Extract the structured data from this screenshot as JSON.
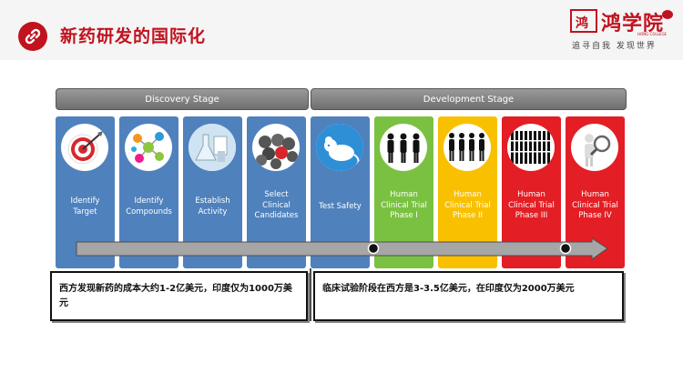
{
  "header": {
    "title": "新药研发的国际化",
    "logo": {
      "mark": "鸿",
      "name": "鸿学院",
      "sub": "HONG COLLEGE",
      "slogan": "追寻自我 发现世界"
    }
  },
  "stages": {
    "discovery": "Discovery Stage",
    "development": "Development Stage"
  },
  "cards": [
    {
      "label": "Identify\nTarget",
      "icon": "target-icon",
      "color": "#4f81bd"
    },
    {
      "label": "Identify\nCompounds",
      "icon": "molecule-icon",
      "color": "#4f81bd"
    },
    {
      "label": "Establish\nActivity",
      "icon": "lab-icon",
      "color": "#4f81bd"
    },
    {
      "label": "Select\nClinical\nCandidates",
      "icon": "candidates-icon",
      "color": "#4f81bd"
    },
    {
      "label": "Test Safety",
      "icon": "mouse-icon",
      "color": "#4f81bd"
    },
    {
      "label": "Human\nClinical Trial\nPhase I",
      "icon": "people-icon",
      "color": "#7ac142"
    },
    {
      "label": "Human\nClinical Trial\nPhase II",
      "icon": "people-icon",
      "color": "#f9c000"
    },
    {
      "label": "Human\nClinical Trial\nPhase III",
      "icon": "crowd-icon",
      "color": "#e31e24"
    },
    {
      "label": "Human\nClinical Trial\nPhase IV",
      "icon": "magnifier-icon",
      "color": "#e31e24"
    }
  ],
  "notes": {
    "left": "西方发现新药的成本大约1-2亿美元，印度仅为1000万美元",
    "right": "临床试验阶段在西方是3-3.5亿美元，在印度仅为2000万美元"
  },
  "colors": {
    "brand": "#c0121f",
    "discovery": "#4f81bd",
    "phase1": "#7ac142",
    "phase2": "#f9c000",
    "phase3": "#e31e24"
  }
}
